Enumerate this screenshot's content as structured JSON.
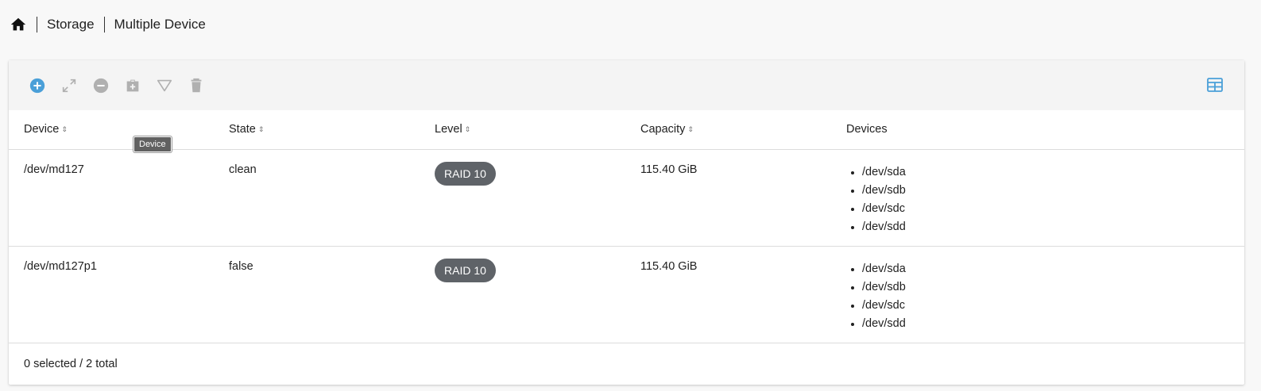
{
  "breadcrumb": {
    "home_icon": "home-icon",
    "items": [
      "Storage",
      "Multiple Device"
    ]
  },
  "toolbar": {
    "icons": [
      "add-circle-icon",
      "expand-icon",
      "remove-circle-icon",
      "briefcase-plus-icon",
      "filter-icon",
      "delete-icon"
    ],
    "right_icon": "table-view-icon",
    "accent": "#4a9fd8",
    "disabled": "#b0b0b0"
  },
  "table": {
    "columns": [
      "Device",
      "State",
      "Level",
      "Capacity",
      "Devices"
    ],
    "rows": [
      {
        "device": "/dev/md127",
        "state": "clean",
        "level": "RAID 10",
        "capacity": "115.40 GiB",
        "devices": [
          "/dev/sda",
          "/dev/sdb",
          "/dev/sdc",
          "/dev/sdd"
        ]
      },
      {
        "device": "/dev/md127p1",
        "state": "false",
        "level": "RAID 10",
        "capacity": "115.40 GiB",
        "devices": [
          "/dev/sda",
          "/dev/sdb",
          "/dev/sdc",
          "/dev/sdd"
        ]
      }
    ]
  },
  "footer": {
    "summary": "0 selected / 2 total"
  },
  "tooltip": {
    "text": "Device"
  }
}
